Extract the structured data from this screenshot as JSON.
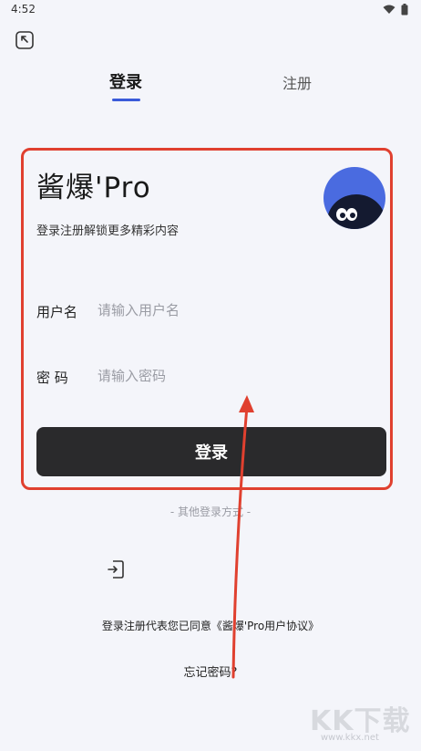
{
  "status_bar": {
    "time": "4:52"
  },
  "tabs": {
    "login_label": "登录",
    "register_label": "注册"
  },
  "brand": {
    "title": "酱爆'Pro",
    "subtitle": "登录注册解锁更多精彩内容"
  },
  "form": {
    "username_label": "用户名",
    "username_placeholder": "请输入用户名",
    "password_label": "密 码",
    "password_placeholder": "请输入密码",
    "submit_label": "登录"
  },
  "other_login": {
    "label": "- 其他登录方式 -"
  },
  "agreement": {
    "text": "登录注册代表您已同意《酱爆'Pro用户协议》"
  },
  "forgot_password": {
    "label": "忘记密码?"
  },
  "watermark": {
    "text": "KK下载",
    "url": "www.kkx.net"
  },
  "colors": {
    "accent": "#3a5bd9",
    "button": "#2a2a2c",
    "annotation": "#e0402f",
    "avatar_bg": "#4a6be0"
  },
  "icons": [
    "wifi-icon",
    "battery-icon",
    "back-icon",
    "avatar-icon",
    "login-switch-icon"
  ]
}
